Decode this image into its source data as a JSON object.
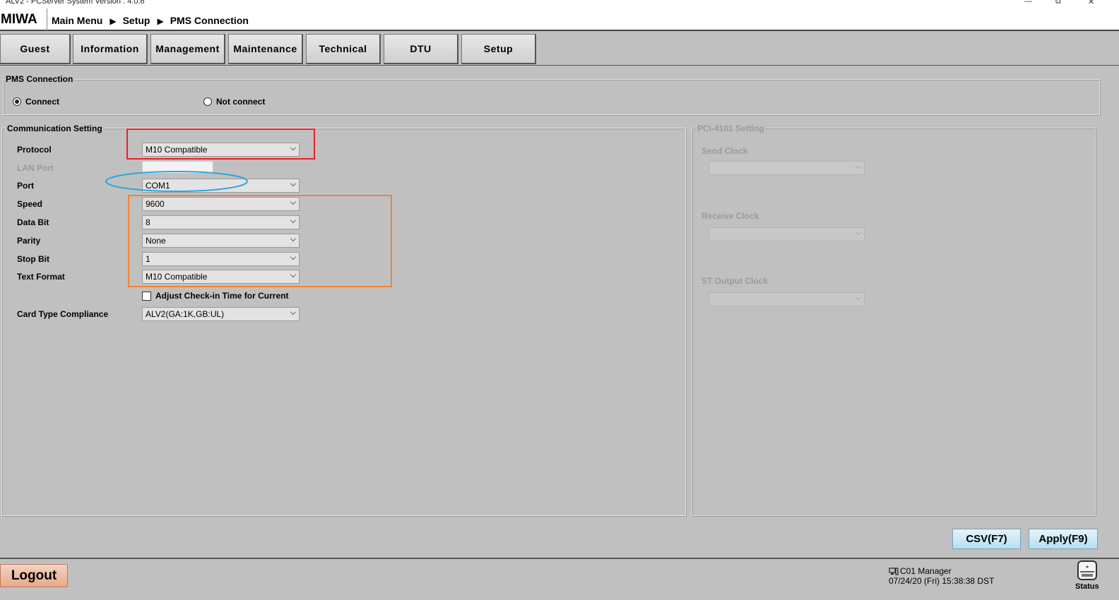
{
  "window": {
    "title": "ALV2 - PCServer System Version : 4.0.6",
    "minimize_glyph": "—",
    "restore_glyph": "⧉",
    "close_glyph": "✕"
  },
  "header": {
    "logo": "MIWA",
    "breadcrumb": [
      "Main Menu",
      "Setup",
      "PMS Connection"
    ],
    "separator": "▶"
  },
  "tabs": [
    "Guest",
    "Information",
    "Management",
    "Maintenance",
    "Technical",
    "DTU",
    "Setup"
  ],
  "pms_connection": {
    "title": "PMS Connection",
    "options": [
      {
        "label": "Connect",
        "selected": true
      },
      {
        "label": "Not connect",
        "selected": false
      }
    ]
  },
  "communication": {
    "title": "Communication Setting",
    "protocol": {
      "label": "Protocol",
      "value": "M10 Compatible"
    },
    "lan_port": {
      "label": "LAN Port",
      "value": ""
    },
    "port": {
      "label": "Port",
      "value": "COM1"
    },
    "speed": {
      "label": "Speed",
      "value": "9600"
    },
    "data_bit": {
      "label": "Data Bit",
      "value": "8"
    },
    "parity": {
      "label": "Parity",
      "value": "None"
    },
    "stop_bit": {
      "label": "Stop Bit",
      "value": "1"
    },
    "text_format": {
      "label": "Text Format",
      "value": "M10 Compatible"
    },
    "adjust_checkin": {
      "label": "Adjust Check-in Time for Current",
      "checked": false
    },
    "card_type": {
      "label": "Card Type Compliance",
      "value": "ALV2(GA:1K,GB:UL)"
    }
  },
  "pci_setting": {
    "title": "PCI-4101 Setting",
    "send_clock": {
      "label": "Send Clock",
      "value": ""
    },
    "receive_clock": {
      "label": "Receive Clock",
      "value": ""
    },
    "st_output_clock": {
      "label": "ST Output Clock",
      "value": ""
    }
  },
  "actions": {
    "csv": "CSV(F7)",
    "apply": "Apply(F9)",
    "logout": "Logout"
  },
  "status": {
    "user": "C01 Manager",
    "datetime": "07/24/20 (Fri) 15:38:38 DST",
    "label": "Status"
  },
  "colors": {
    "background": "#c0c0c0",
    "annotation_red": "#e8202a",
    "annotation_blue": "#29a6e0",
    "annotation_orange": "#f08434"
  }
}
